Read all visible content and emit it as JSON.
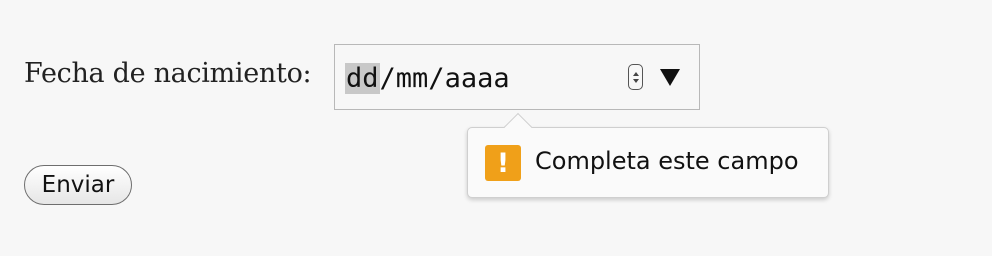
{
  "form": {
    "birthdate_label": "Fecha de nacimiento:",
    "date_placeholder": {
      "day": "dd",
      "sep1": "/",
      "month": "mm",
      "sep2": "/",
      "year": "aaaa"
    },
    "submit_label": "Enviar"
  },
  "validation_tooltip": {
    "icon": "warning-icon",
    "icon_glyph": "!",
    "message": "Completa este campo",
    "accent_color": "#f0a019"
  }
}
